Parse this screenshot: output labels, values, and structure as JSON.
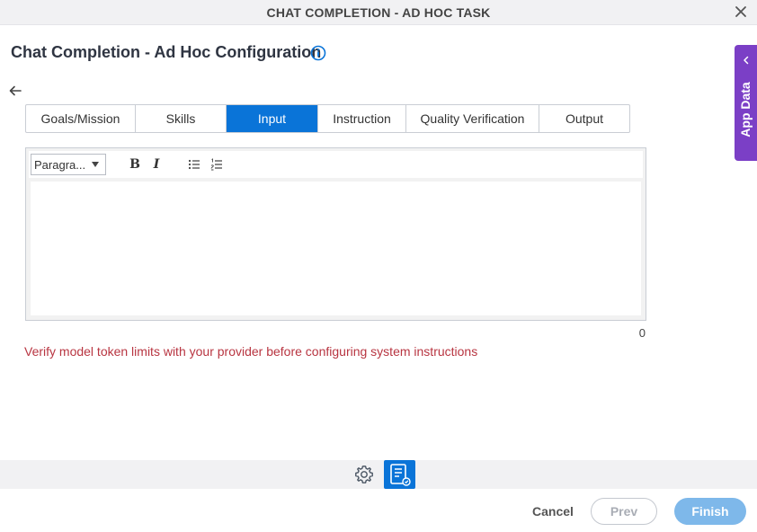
{
  "window": {
    "title": "CHAT COMPLETION - AD HOC TASK"
  },
  "header": {
    "page_title": "Chat Completion - Ad Hoc Configuration"
  },
  "tabs": [
    {
      "label": "Goals/Mission",
      "active": false
    },
    {
      "label": "Skills",
      "active": false
    },
    {
      "label": "Input",
      "active": true
    },
    {
      "label": "Instruction",
      "active": false
    },
    {
      "label": "Quality Verification",
      "active": false
    },
    {
      "label": "Output",
      "active": false
    }
  ],
  "editor": {
    "paragraph_select": "Paragra...",
    "toolbar_buttons": [
      "bold",
      "italic",
      "bulleted-list",
      "numbered-list"
    ],
    "content": "",
    "char_count": "0"
  },
  "warning_text": "Verify model token limits with your provider before configuring system instructions",
  "side_panel": {
    "label": "App Data"
  },
  "footer": {
    "cancel_label": "Cancel",
    "prev_label": "Prev",
    "finish_label": "Finish"
  },
  "colors": {
    "accent": "#0a74d8",
    "app_data_tab": "#7b3fc6",
    "warning": "#b83541",
    "finish_disabled": "#7eb8ea"
  }
}
